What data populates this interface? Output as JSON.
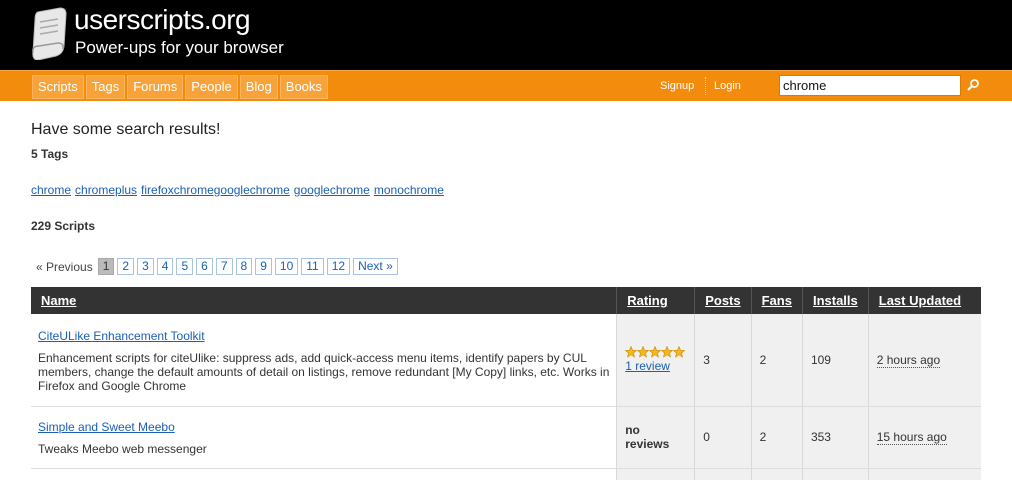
{
  "header": {
    "title": "userscripts.org",
    "tagline": "Power-ups for your browser"
  },
  "nav": {
    "items": [
      "Scripts",
      "Tags",
      "Forums",
      "People",
      "Blog",
      "Books"
    ],
    "signup": "Signup",
    "login": "Login",
    "search_value": "chrome"
  },
  "content": {
    "heading": "Have some search results!",
    "tag_count": "5 Tags",
    "tags": [
      "chrome",
      "chromeplus",
      "firefoxchromegooglechrome",
      "googlechrome",
      "monochrome"
    ],
    "script_count": "229 Scripts"
  },
  "pager": {
    "prev": "« Previous",
    "pages": [
      "1",
      "2",
      "3",
      "4",
      "5",
      "6",
      "7",
      "8",
      "9",
      "10",
      "11",
      "12"
    ],
    "current": "1",
    "next": "Next »"
  },
  "table": {
    "headers": [
      "Name",
      "Rating",
      "Posts",
      "Fans",
      "Installs",
      "Last Updated"
    ],
    "rows": [
      {
        "name": "CiteULike Enhancement Toolkit",
        "description": "Enhancement scripts for citeUlike: suppress ads, add quick-access menu items, identify papers by CUL members, change the default amounts of detail on listings, remove redundant [My Copy] links, etc. Works in Firefox and Google Chrome",
        "rating_stars": 5,
        "rating_text": "1 review",
        "posts": "3",
        "fans": "2",
        "installs": "109",
        "updated": "2 hours ago"
      },
      {
        "name": "Simple and Sweet Meebo",
        "description": "Tweaks Meebo web messenger",
        "rating_text": "no reviews",
        "posts": "0",
        "fans": "2",
        "installs": "353",
        "updated": "15 hours ago"
      }
    ]
  },
  "colors": {
    "header_bg": "#000000",
    "nav_bg": "#f38b0d",
    "link": "#1a5fb4",
    "table_header_bg": "#333333",
    "star": "#f5b81c"
  }
}
